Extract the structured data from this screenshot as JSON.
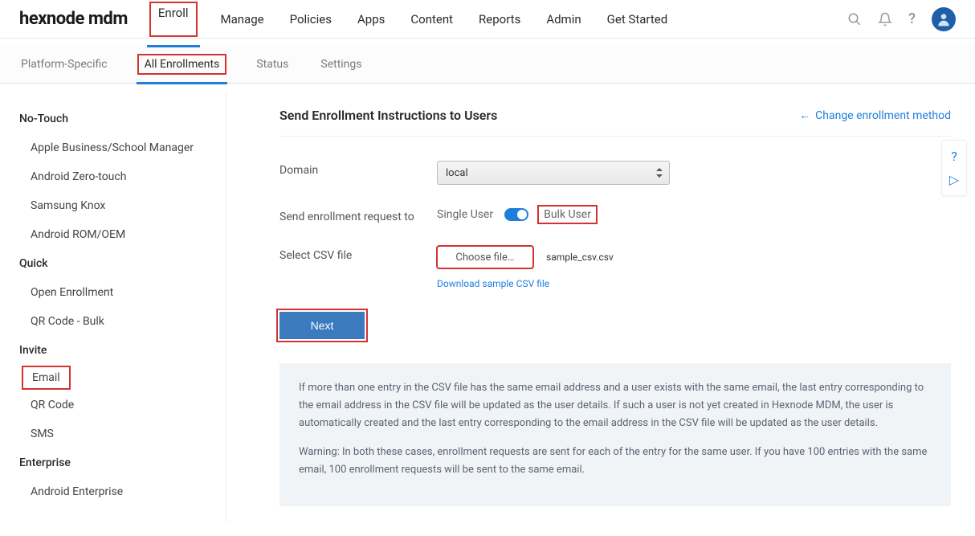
{
  "logo": "hexnode mdm",
  "nav": [
    "Enroll",
    "Manage",
    "Policies",
    "Apps",
    "Content",
    "Reports",
    "Admin",
    "Get Started"
  ],
  "subtabs": [
    "Platform-Specific",
    "All Enrollments",
    "Status",
    "Settings"
  ],
  "sidebar": {
    "groups": [
      {
        "label": "No-Touch",
        "items": [
          "Apple Business/School Manager",
          "Android Zero-touch",
          "Samsung Knox",
          "Android ROM/OEM"
        ]
      },
      {
        "label": "Quick",
        "items": [
          "Open Enrollment",
          "QR Code - Bulk"
        ]
      },
      {
        "label": "Invite",
        "items": [
          "Email",
          "QR Code",
          "SMS"
        ]
      },
      {
        "label": "Enterprise",
        "items": [
          "Android Enterprise"
        ]
      }
    ]
  },
  "main": {
    "title": "Send Enrollment Instructions to Users",
    "change_link": "Change enrollment method",
    "domain_label": "Domain",
    "domain_value": "local",
    "request_label": "Send enrollment request to",
    "single_user": "Single User",
    "bulk_user": "Bulk User",
    "csv_label": "Select CSV file",
    "choose_file": "Choose file…",
    "file_name": "sample_csv.csv",
    "download_link": "Download sample CSV file",
    "next": "Next",
    "info1": "If more than one entry in the CSV file has the same email address and a user exists with the same email, the last entry corresponding to the email address in the CSV file will be updated as the user details. If such a user is not yet created in Hexnode MDM, the user is automatically created and the last entry corresponding to the email address in the CSV file will be updated as the user details.",
    "info2": "Warning: In both these cases, enrollment requests are sent for each of the entry for the same user. If you have 100 entries with the same email, 100 enrollment requests will be sent to the same email."
  }
}
